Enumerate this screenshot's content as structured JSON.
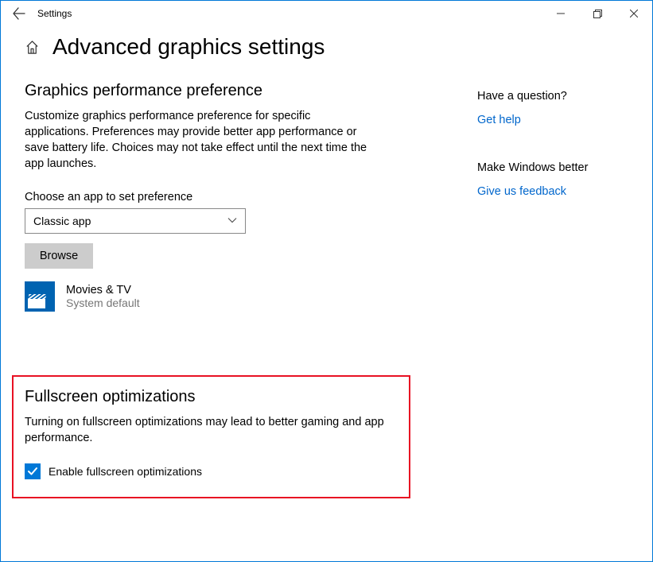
{
  "window": {
    "title": "Settings"
  },
  "header": {
    "page_title": "Advanced graphics settings"
  },
  "pref": {
    "title": "Graphics performance preference",
    "description": "Customize graphics performance preference for specific applications. Preferences may provide better app performance or save battery life. Choices may not take effect until the next time the app launches.",
    "choose_label": "Choose an app to set preference",
    "dropdown_value": "Classic app",
    "browse_label": "Browse",
    "app": {
      "name": "Movies & TV",
      "subtitle": "System default"
    }
  },
  "fullscreen": {
    "title": "Fullscreen optimizations",
    "description": "Turning on fullscreen optimizations may lead to better gaming and app performance.",
    "checkbox_label": "Enable fullscreen optimizations",
    "checked": true
  },
  "side": {
    "question_title": "Have a question?",
    "help_link": "Get help",
    "feedback_title": "Make Windows better",
    "feedback_link": "Give us feedback"
  }
}
